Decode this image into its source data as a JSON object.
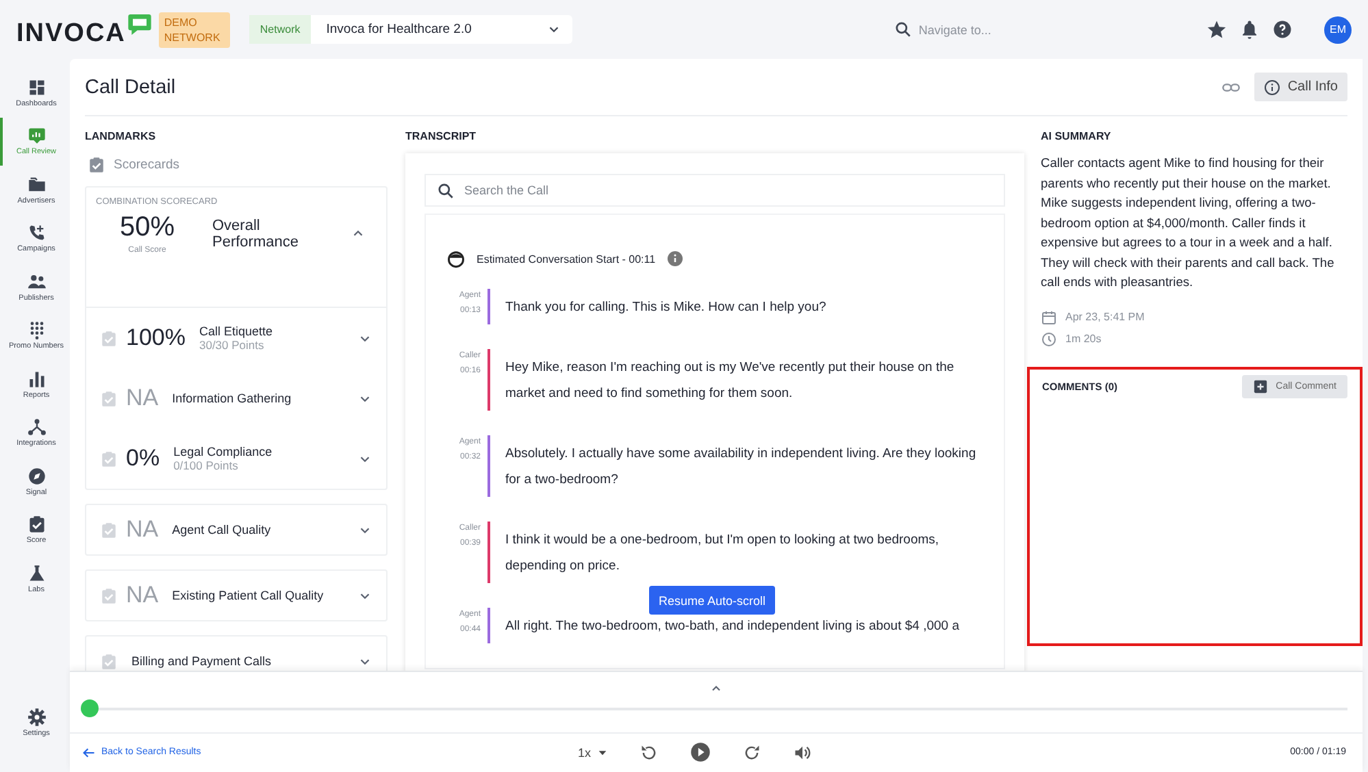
{
  "topbar": {
    "logo": "INVOCA",
    "badge": "DEMO NETWORK",
    "network_label": "Network",
    "network_value": "Invoca for Healthcare 2.0",
    "search_placeholder": "Navigate to...",
    "avatar": "EM"
  },
  "sidebar": {
    "items": [
      {
        "label": "Dashboards",
        "selected": false
      },
      {
        "label": "Call Review",
        "selected": true
      },
      {
        "label": "Advertisers",
        "selected": false
      },
      {
        "label": "Campaigns",
        "selected": false
      },
      {
        "label": "Publishers",
        "selected": false
      },
      {
        "label": "Promo Numbers",
        "selected": false
      },
      {
        "label": "Reports",
        "selected": false
      },
      {
        "label": "Integrations",
        "selected": false
      },
      {
        "label": "Signal",
        "selected": false
      },
      {
        "label": "Score",
        "selected": false
      },
      {
        "label": "Labs",
        "selected": false
      }
    ],
    "settings": "Settings"
  },
  "page": {
    "title": "Call Detail",
    "call_info_button": "Call Info"
  },
  "landmarks": {
    "heading": "LANDMARKS",
    "scorecards_label": "Scorecards",
    "combination": {
      "label": "COMBINATION SCORECARD",
      "score": "50%",
      "score_caption": "Call Score",
      "name": "Overall Performance",
      "expanded": true,
      "items": [
        {
          "score": "100%",
          "name": "Call Etiquette",
          "points": "30/30 Points",
          "muted": false
        },
        {
          "score": "NA",
          "name": "Information Gathering",
          "muted": true
        },
        {
          "score": "0%",
          "name": "Legal Compliance",
          "points": "0/100 Points",
          "muted": false
        }
      ]
    },
    "cards": [
      {
        "score": "NA",
        "name": "Agent Call Quality",
        "muted": true
      },
      {
        "score": "NA",
        "name": "Existing Patient Call Quality",
        "muted": true
      },
      {
        "name": "Billing and Payment Calls"
      }
    ]
  },
  "transcript": {
    "heading": "TRANSCRIPT",
    "search_placeholder": "Search the Call",
    "start": "Estimated Conversation Start - 00:11",
    "entries": [
      {
        "kind": "agent",
        "speaker": "Agent",
        "time": "00:13",
        "text": "Thank you for calling. This is Mike. How can I help you?"
      },
      {
        "kind": "caller",
        "speaker": "Caller",
        "time": "00:16",
        "text": "Hey Mike, reason I'm reaching out is my We've recently put their house on the market and need to find something for them soon."
      },
      {
        "kind": "agent",
        "speaker": "Agent",
        "time": "00:32",
        "text": "Absolutely. I actually have some availability in independent living. Are they looking for a two-bedroom?"
      },
      {
        "kind": "caller",
        "speaker": "Caller",
        "time": "00:39",
        "text": "I think it would be a one-bedroom, but I'm open to looking at two bedrooms, depending on price."
      },
      {
        "kind": "agent",
        "speaker": "Agent",
        "time": "00:44",
        "text": "All right. The two-bedroom, two-bath, and independent living is about $4 ,000 a"
      }
    ],
    "resume_button": "Resume Auto-scroll"
  },
  "summary": {
    "heading": "AI SUMMARY",
    "text": "Caller contacts agent Mike to find housing for their parents who recently put their house on the market. Mike suggests independent living, offering a two-bedroom option at $4,000/month. Caller finds it expensive but agrees to a tour in a week and a half. They will check with their parents and call back. The call ends with pleasantries.",
    "date": "Apr 23, 5:41 PM",
    "duration": "1m 20s"
  },
  "comments": {
    "heading": "COMMENTS (0)",
    "button": "Call Comment",
    "highlighted": true
  },
  "player": {
    "level": 0,
    "back_link": "Back to Search Results",
    "speed": "1x",
    "time": "00:00 / 01:19"
  }
}
